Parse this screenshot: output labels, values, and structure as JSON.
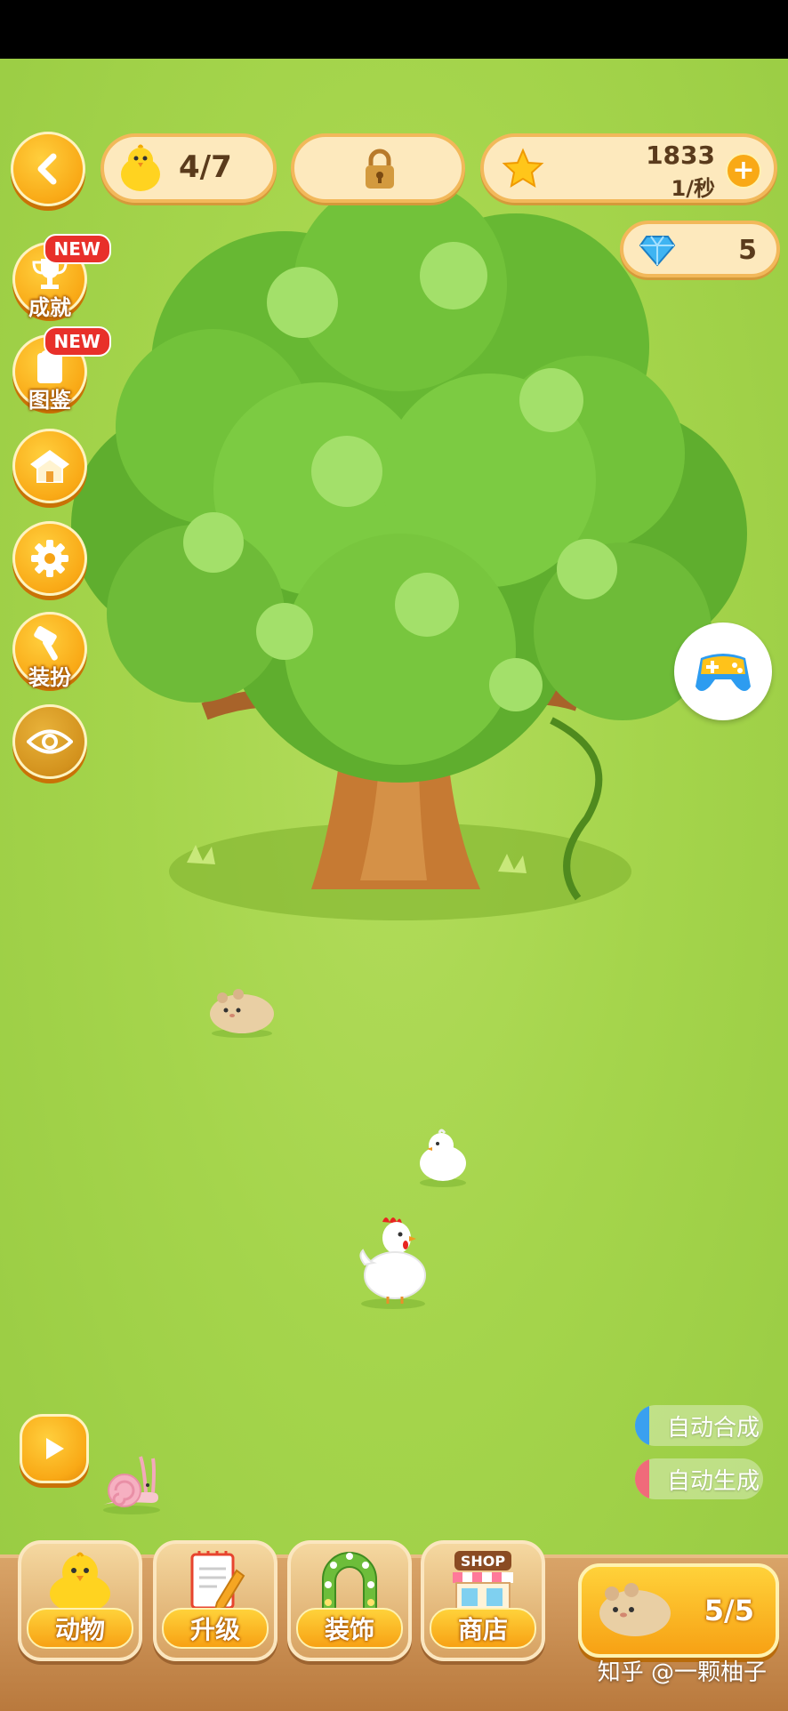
{
  "hud": {
    "chick_count": "4/7",
    "coins": "1833",
    "coin_rate": "1/秒",
    "gems": "5"
  },
  "side_menu": {
    "achievement_label": "成就",
    "achievement_badge": "NEW",
    "collection_label": "图鉴",
    "collection_badge": "NEW",
    "dress_label": "装扮"
  },
  "toggles": {
    "auto_merge": "自动合成",
    "auto_generate": "自动生成"
  },
  "tabs": [
    {
      "label": "动物"
    },
    {
      "label": "升级"
    },
    {
      "label": "装饰"
    },
    {
      "label": "商店",
      "sign": "SHOP"
    }
  ],
  "spawn": {
    "count": "5/5"
  },
  "watermark": "知乎 @一颗柚子",
  "colors": {
    "grass": "#a5d54c",
    "accent_orange": "#f9a916",
    "pill_bg": "#fde9bd",
    "badge_red": "#e8302a"
  }
}
